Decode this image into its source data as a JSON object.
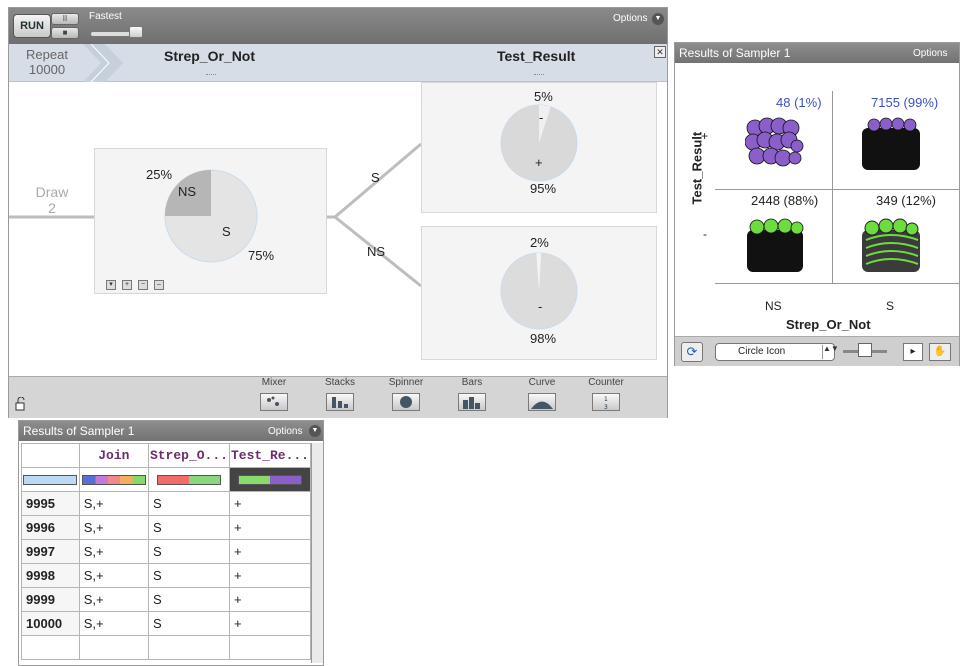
{
  "sampler": {
    "toolbar": {
      "run_label": "RUN",
      "pause_label": "II",
      "stop_label": "■",
      "speed_label": "Fastest",
      "options_label": "Options"
    },
    "header": {
      "repeat_label": "Repeat",
      "repeat_value": "10000",
      "col1_title": "Strep_Or_Not",
      "col2_title": "Test_Result",
      "close_label": "✕"
    },
    "draw_label": "Draw",
    "draw_value": "2",
    "strep_device": {
      "ns_label": "NS",
      "s_label": "S",
      "ns_pct": "25%",
      "s_pct": "75%",
      "ns_fraction": 0.25
    },
    "branch_s_label": "S",
    "branch_ns_label": "NS",
    "test_device_s": {
      "minus_label": "-",
      "plus_label": "+",
      "minus_pct": "5%",
      "plus_pct": "95%",
      "minus_fraction": 0.05
    },
    "test_device_ns": {
      "minus_label": "-",
      "plus_label": "-",
      "top_pct": "2%",
      "bottom_pct": "98%",
      "top_fraction": 0.02
    },
    "footer": {
      "tools": [
        {
          "label": "Mixer"
        },
        {
          "label": "Stacks"
        },
        {
          "label": "Spinner"
        },
        {
          "label": "Bars"
        },
        {
          "label": "Curve"
        },
        {
          "label": "Counter"
        }
      ]
    }
  },
  "graph": {
    "title": "Results of Sampler 1",
    "options_label": "Options",
    "y_axis_label": "Test_Result",
    "x_axis_label": "Strep_Or_Not",
    "y_plus": "+",
    "y_minus": "-",
    "x_ns": "NS",
    "x_s": "S",
    "counts": {
      "ns_plus": "48 (1%)",
      "s_plus": "7155 (99%)",
      "ns_minus": "2448 (88%)",
      "s_minus": "349 (12%)"
    },
    "colors": {
      "purple": "#8a5fc9",
      "black": "#111111",
      "green": "#6ddc3e",
      "blue_text": "#3a4fc4"
    },
    "icon_select_value": "Circle Icon"
  },
  "table": {
    "title": "Results of Sampler 1",
    "options_label": "Options",
    "columns": [
      "Join",
      "Strep_O...",
      "Test_Re..."
    ],
    "rows": [
      {
        "num": "9995",
        "join": "S,+",
        "strep": "S",
        "test": "+"
      },
      {
        "num": "9996",
        "join": "S,+",
        "strep": "S",
        "test": "+"
      },
      {
        "num": "9997",
        "join": "S,+",
        "strep": "S",
        "test": "+"
      },
      {
        "num": "9998",
        "join": "S,+",
        "strep": "S",
        "test": "+"
      },
      {
        "num": "9999",
        "join": "S,+",
        "strep": "S",
        "test": "+"
      },
      {
        "num": "10000",
        "join": "S,+",
        "strep": "S",
        "test": "+"
      }
    ]
  }
}
